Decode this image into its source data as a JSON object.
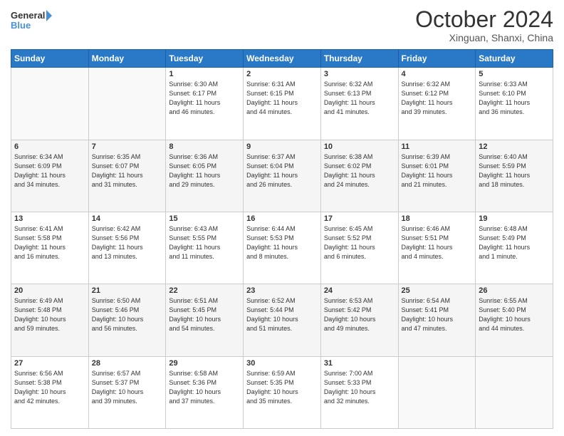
{
  "header": {
    "logo_line1": "General",
    "logo_line2": "Blue",
    "month": "October 2024",
    "location": "Xinguan, Shanxi, China"
  },
  "weekdays": [
    "Sunday",
    "Monday",
    "Tuesday",
    "Wednesday",
    "Thursday",
    "Friday",
    "Saturday"
  ],
  "weeks": [
    [
      {
        "day": "",
        "info": ""
      },
      {
        "day": "",
        "info": ""
      },
      {
        "day": "1",
        "info": "Sunrise: 6:30 AM\nSunset: 6:17 PM\nDaylight: 11 hours\nand 46 minutes."
      },
      {
        "day": "2",
        "info": "Sunrise: 6:31 AM\nSunset: 6:15 PM\nDaylight: 11 hours\nand 44 minutes."
      },
      {
        "day": "3",
        "info": "Sunrise: 6:32 AM\nSunset: 6:13 PM\nDaylight: 11 hours\nand 41 minutes."
      },
      {
        "day": "4",
        "info": "Sunrise: 6:32 AM\nSunset: 6:12 PM\nDaylight: 11 hours\nand 39 minutes."
      },
      {
        "day": "5",
        "info": "Sunrise: 6:33 AM\nSunset: 6:10 PM\nDaylight: 11 hours\nand 36 minutes."
      }
    ],
    [
      {
        "day": "6",
        "info": "Sunrise: 6:34 AM\nSunset: 6:09 PM\nDaylight: 11 hours\nand 34 minutes."
      },
      {
        "day": "7",
        "info": "Sunrise: 6:35 AM\nSunset: 6:07 PM\nDaylight: 11 hours\nand 31 minutes."
      },
      {
        "day": "8",
        "info": "Sunrise: 6:36 AM\nSunset: 6:05 PM\nDaylight: 11 hours\nand 29 minutes."
      },
      {
        "day": "9",
        "info": "Sunrise: 6:37 AM\nSunset: 6:04 PM\nDaylight: 11 hours\nand 26 minutes."
      },
      {
        "day": "10",
        "info": "Sunrise: 6:38 AM\nSunset: 6:02 PM\nDaylight: 11 hours\nand 24 minutes."
      },
      {
        "day": "11",
        "info": "Sunrise: 6:39 AM\nSunset: 6:01 PM\nDaylight: 11 hours\nand 21 minutes."
      },
      {
        "day": "12",
        "info": "Sunrise: 6:40 AM\nSunset: 5:59 PM\nDaylight: 11 hours\nand 18 minutes."
      }
    ],
    [
      {
        "day": "13",
        "info": "Sunrise: 6:41 AM\nSunset: 5:58 PM\nDaylight: 11 hours\nand 16 minutes."
      },
      {
        "day": "14",
        "info": "Sunrise: 6:42 AM\nSunset: 5:56 PM\nDaylight: 11 hours\nand 13 minutes."
      },
      {
        "day": "15",
        "info": "Sunrise: 6:43 AM\nSunset: 5:55 PM\nDaylight: 11 hours\nand 11 minutes."
      },
      {
        "day": "16",
        "info": "Sunrise: 6:44 AM\nSunset: 5:53 PM\nDaylight: 11 hours\nand 8 minutes."
      },
      {
        "day": "17",
        "info": "Sunrise: 6:45 AM\nSunset: 5:52 PM\nDaylight: 11 hours\nand 6 minutes."
      },
      {
        "day": "18",
        "info": "Sunrise: 6:46 AM\nSunset: 5:51 PM\nDaylight: 11 hours\nand 4 minutes."
      },
      {
        "day": "19",
        "info": "Sunrise: 6:48 AM\nSunset: 5:49 PM\nDaylight: 11 hours\nand 1 minute."
      }
    ],
    [
      {
        "day": "20",
        "info": "Sunrise: 6:49 AM\nSunset: 5:48 PM\nDaylight: 10 hours\nand 59 minutes."
      },
      {
        "day": "21",
        "info": "Sunrise: 6:50 AM\nSunset: 5:46 PM\nDaylight: 10 hours\nand 56 minutes."
      },
      {
        "day": "22",
        "info": "Sunrise: 6:51 AM\nSunset: 5:45 PM\nDaylight: 10 hours\nand 54 minutes."
      },
      {
        "day": "23",
        "info": "Sunrise: 6:52 AM\nSunset: 5:44 PM\nDaylight: 10 hours\nand 51 minutes."
      },
      {
        "day": "24",
        "info": "Sunrise: 6:53 AM\nSunset: 5:42 PM\nDaylight: 10 hours\nand 49 minutes."
      },
      {
        "day": "25",
        "info": "Sunrise: 6:54 AM\nSunset: 5:41 PM\nDaylight: 10 hours\nand 47 minutes."
      },
      {
        "day": "26",
        "info": "Sunrise: 6:55 AM\nSunset: 5:40 PM\nDaylight: 10 hours\nand 44 minutes."
      }
    ],
    [
      {
        "day": "27",
        "info": "Sunrise: 6:56 AM\nSunset: 5:38 PM\nDaylight: 10 hours\nand 42 minutes."
      },
      {
        "day": "28",
        "info": "Sunrise: 6:57 AM\nSunset: 5:37 PM\nDaylight: 10 hours\nand 39 minutes."
      },
      {
        "day": "29",
        "info": "Sunrise: 6:58 AM\nSunset: 5:36 PM\nDaylight: 10 hours\nand 37 minutes."
      },
      {
        "day": "30",
        "info": "Sunrise: 6:59 AM\nSunset: 5:35 PM\nDaylight: 10 hours\nand 35 minutes."
      },
      {
        "day": "31",
        "info": "Sunrise: 7:00 AM\nSunset: 5:33 PM\nDaylight: 10 hours\nand 32 minutes."
      },
      {
        "day": "",
        "info": ""
      },
      {
        "day": "",
        "info": ""
      }
    ]
  ]
}
